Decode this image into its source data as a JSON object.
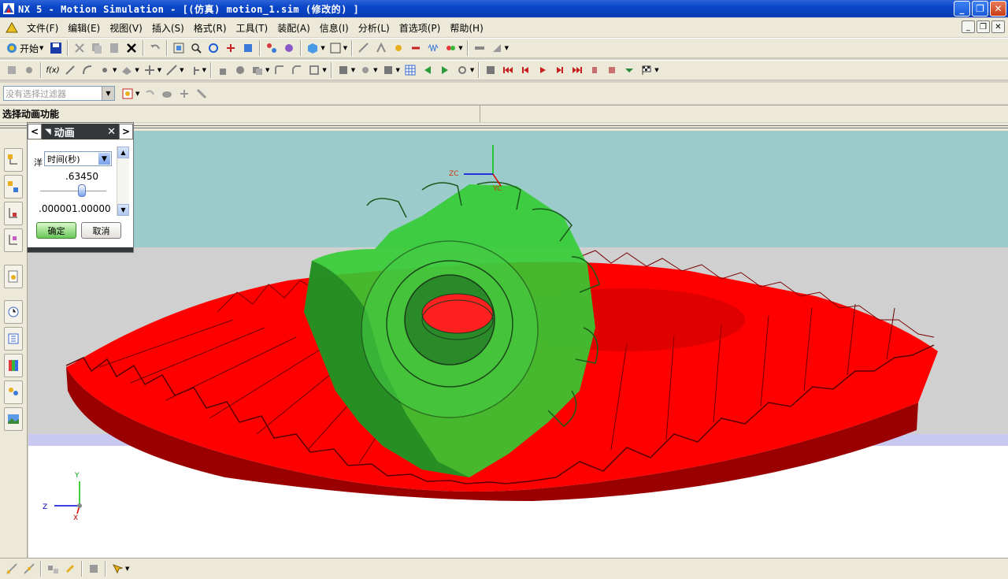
{
  "window": {
    "title": "NX 5 - Motion Simulation - [(仿真) motion_1.sim  (修改的) ]",
    "buttons": [
      "minimize",
      "restore",
      "close"
    ]
  },
  "menu": {
    "items": [
      "文件(F)",
      "编辑(E)",
      "视图(V)",
      "插入(S)",
      "格式(R)",
      "工具(T)",
      "装配(A)",
      "信息(I)",
      "分析(L)",
      "首选项(P)",
      "帮助(H)"
    ]
  },
  "toolbar": {
    "start_label": "开始",
    "filter_placeholder": "没有选择过滤器"
  },
  "status": {
    "prompt": "选择动画功能"
  },
  "dialog": {
    "title": "动画",
    "field_prefix": "洋",
    "select_value": "时间(秒)",
    "current_value": ".63450",
    "slider_fraction": 0.6345,
    "range_text": ".000001.00000",
    "ok_label": "确定",
    "cancel_label": "取消"
  },
  "viewport": {
    "triad": {
      "x": "X",
      "y": "Y",
      "z": "Z"
    },
    "wcs": {
      "zc": "ZC",
      "yc": "YC"
    },
    "colors": {
      "sky": "#9ccbcc",
      "floor": "#d0d0d0",
      "gear_large": "#ff0000",
      "gear_small": "#33cc33"
    }
  }
}
